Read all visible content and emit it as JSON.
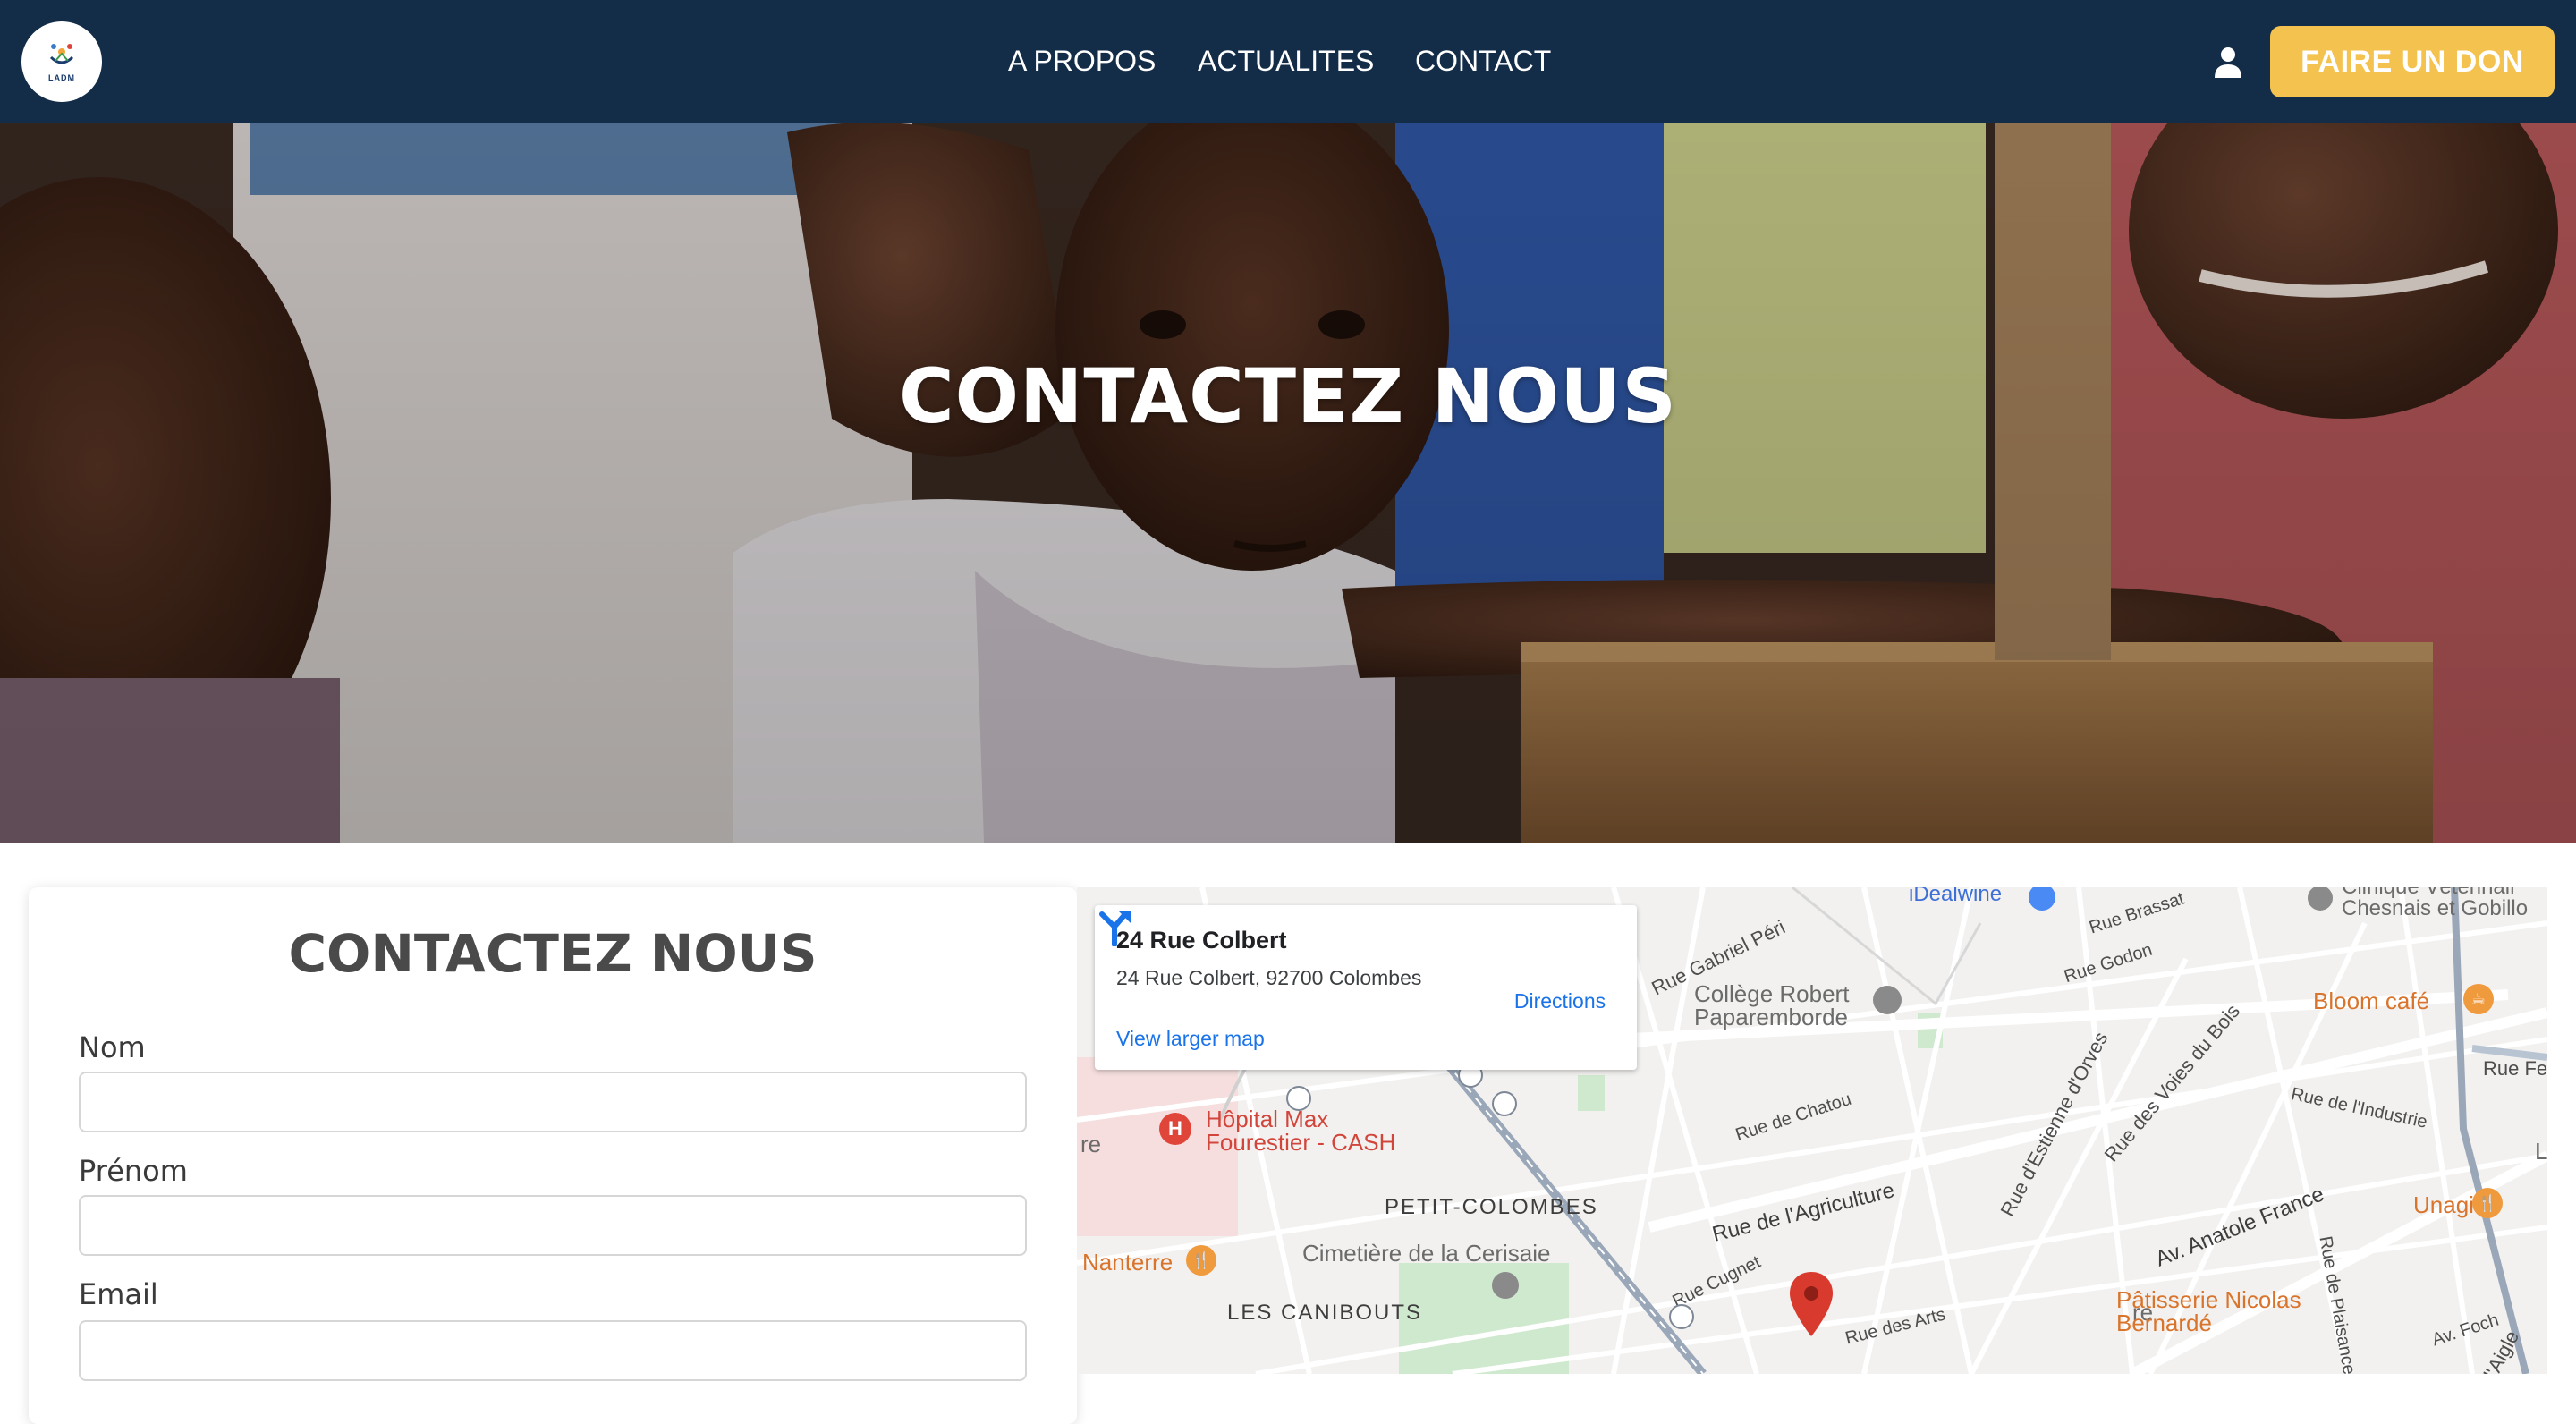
{
  "header": {
    "logo_text": "LADM",
    "nav": [
      "A PROPOS",
      "ACTUALITES",
      "CONTACT"
    ],
    "donate_label": "FAIRE UN DON",
    "icons": {
      "logo": "organization-logo",
      "account": "user-icon"
    },
    "colors": {
      "background": "#132c47",
      "donate": "#f4c24f",
      "text": "#ffffff"
    }
  },
  "hero": {
    "title": "CONTACTEZ NOUS",
    "image": "photo-of-children-at-school-desk"
  },
  "form": {
    "title": "CONTACTEZ NOUS",
    "fields": [
      {
        "label": "Nom",
        "value": ""
      },
      {
        "label": "Prénom",
        "value": ""
      },
      {
        "label": "Email",
        "value": ""
      }
    ]
  },
  "map": {
    "card": {
      "title": "24 Rue Colbert",
      "address": "24 Rue Colbert, 92700 Colombes",
      "directions_label": "Directions",
      "larger_map_label": "View larger map"
    },
    "labels": {
      "idealwine": "iDealwine",
      "clinique_line1": "Clinique Vétérinair",
      "clinique_line2": "Chesnais et Gobillo",
      "college_line1": "Collège Robert",
      "college_line2": "Paparemborde",
      "bloom": "Bloom café",
      "hopital_line1": "Hôpital Max",
      "hopital_line2": "Fourestier - CASH",
      "petit_colombes": "PETIT-COLOMBES",
      "cimetiere": "Cimetière de la Cerisaie",
      "nanterre": "Nanterre",
      "caniboutes": "LES CANIBOUTS",
      "unagi": "Unagi",
      "patisserie_line1": "Pâtisserie Nicolas",
      "patisserie_line2": "Bernardé",
      "re": "re",
      "l": "L",
      "rue_gabriel_peri": "Rue Gabriel Péri",
      "rue_brassat": "Rue Brassat",
      "rue_godon": "Rue Godon",
      "rue_fe": "Rue Fe",
      "rue_industrie": "Rue de l'Industrie",
      "rue_chatou": "Rue de Chatou",
      "rue_estienne": "Rue d'Estienne d'Orves",
      "rue_voies": "Rue des Voies du Bois",
      "rue_agriculture": "Rue de l'Agriculture",
      "av_anatole": "Av. Anatole France",
      "rue_cugnet": "Rue Cugnet",
      "rue_arts": "Rue des Arts",
      "rue_plaisance": "Rue de Plaisance",
      "av_foch": "Av. Foch",
      "aigle": "l'Aigle"
    },
    "colors": {
      "pin": "#d93a2e",
      "link": "#1a73e8",
      "poi_food": "#f09a3e"
    }
  }
}
